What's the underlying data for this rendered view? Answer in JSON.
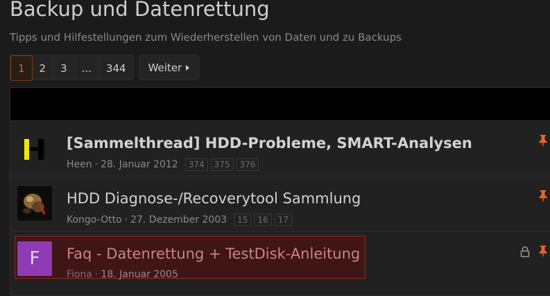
{
  "header": {
    "title": "Backup und Datenrettung",
    "subtitle": "Tipps und Hilfestellungen zum Wiederherstellen von Daten und zu Backups"
  },
  "pagination": {
    "pages": [
      "1",
      "2",
      "3",
      "...",
      "344"
    ],
    "active_page": "1",
    "next_label": "Weiter"
  },
  "threads": [
    {
      "title": "[Sammelthread] HDD-Probleme, SMART-Analysen",
      "author": "Heen",
      "date": "28. Januar 2012",
      "pages": [
        "374",
        "375",
        "376"
      ],
      "pinned": true,
      "locked": false
    },
    {
      "title": "HDD Diagnose-/Recoverytool Sammlung",
      "author": "Kongo-Otto",
      "date": "27. Dezember 2003",
      "pages": [
        "15",
        "16",
        "17"
      ],
      "pinned": true,
      "locked": false
    },
    {
      "title": "Faq - Datenrettung + TestDisk-Anleitung",
      "author": "Fiona",
      "date": "18. Januar 2005",
      "avatar_letter": "F",
      "pinned": true,
      "locked": true
    }
  ],
  "colors": {
    "accent": "#e8652a",
    "highlight_border": "#9c2626",
    "avatar_purple": "#8e3bb5"
  }
}
